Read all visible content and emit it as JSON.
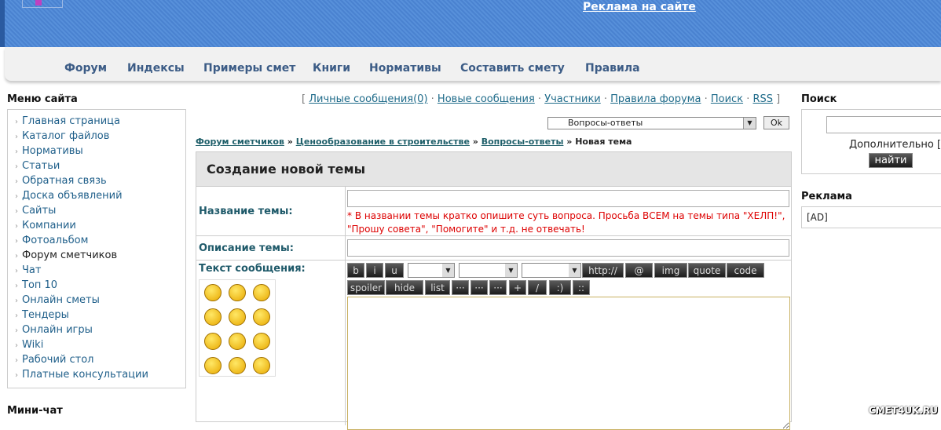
{
  "header": {
    "ad_link": "Реклама на сайте"
  },
  "nav": [
    "Форум",
    "Индексы",
    "Примеры смет",
    "Книги",
    "Нормативы",
    "Составить смету",
    "Правила"
  ],
  "menu": {
    "title": "Меню сайта",
    "items": [
      "Главная страница",
      "Каталог файлов",
      "Нормативы",
      "Статьи",
      "Обратная связь",
      "Доска объявлений",
      "Сайты",
      "Компании",
      "Фотоальбом",
      "Форум сметчиков",
      "Чат",
      "Топ 10",
      "Онлайн сметы",
      "Тендеры",
      "Онлайн игры",
      "Wiki",
      "Рабочий стол",
      "Платные консультации"
    ]
  },
  "minichat": "Мини-чат",
  "toplinks": [
    "Личные сообщения(0)",
    "Новые сообщения",
    "Участники",
    "Правила форума",
    "Поиск",
    "RSS"
  ],
  "forum_select": "Вопросы-ответы",
  "ok": "Ok",
  "breadcrumb": [
    "Форум сметчиков",
    "Ценообразование в строительстве",
    "Вопросы-ответы",
    "Новая тема"
  ],
  "form": {
    "title": "Создание новой темы",
    "topic_label": "Название темы:",
    "topic_value": "",
    "warning": "* В названии темы кратко опишите суть вопроса. Просьба ВСЕМ на темы типа \"ХЕЛП!\", \"Прошу совета\", \"Помогите\" и т.д. не отвечать!",
    "desc_label": "Описание темы:",
    "desc_value": "",
    "text_label": "Текст сообщения:",
    "toolbar1": [
      "b",
      "i",
      "u"
    ],
    "toolbar1b": [
      "http://",
      "@",
      "img",
      "quote",
      "code"
    ],
    "toolbar2": [
      "spoiler",
      "hide",
      "list",
      "···",
      "···",
      "···",
      "+",
      "/",
      ":)",
      "::"
    ]
  },
  "search": {
    "title": "Поиск",
    "advanced": "Дополнительно [+]",
    "button": "найти"
  },
  "ads": {
    "title": "Реклама",
    "content": "[AD]"
  },
  "watermark": "CMET4UK.RU"
}
